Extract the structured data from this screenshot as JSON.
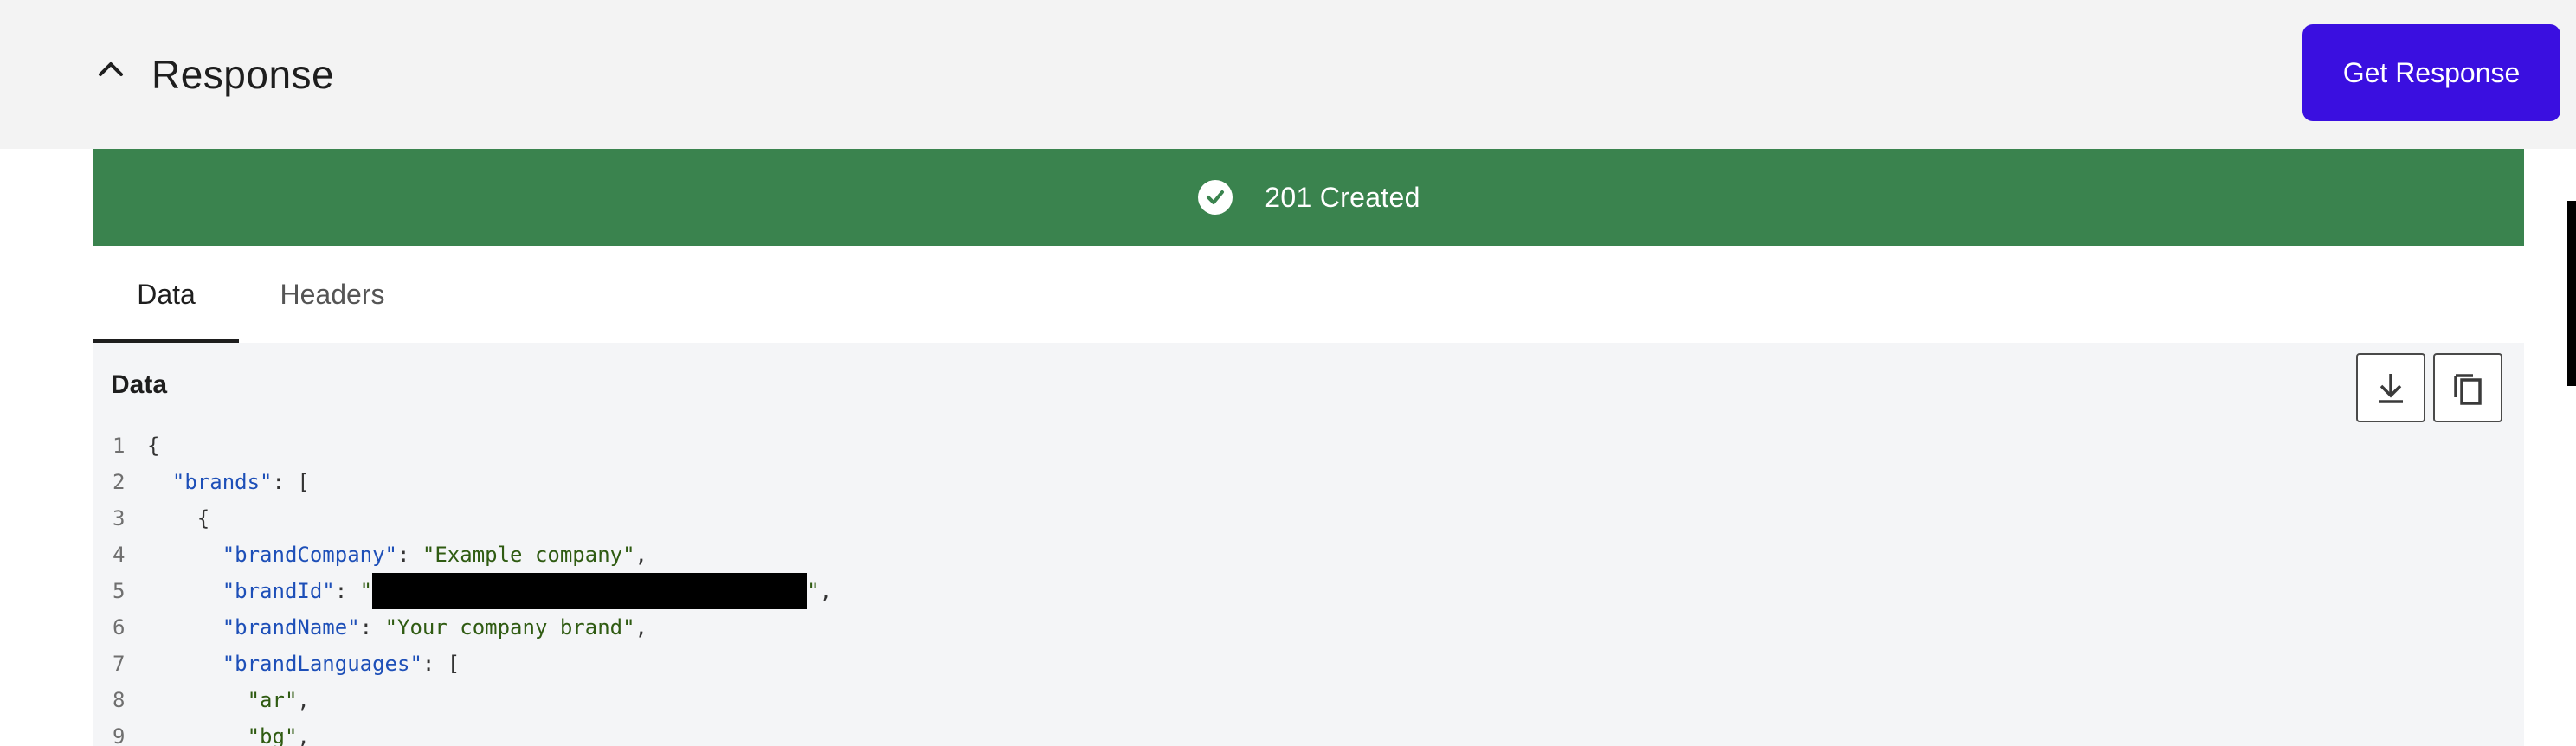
{
  "header": {
    "title": "Response",
    "get_response_label": "Get Response"
  },
  "status": {
    "text": "201 Created",
    "color": "#3a834e"
  },
  "tabs": [
    {
      "label": "Data",
      "active": true
    },
    {
      "label": "Headers",
      "active": false
    }
  ],
  "panel": {
    "title": "Data"
  },
  "code_lines": [
    {
      "n": "1",
      "indent": "",
      "parts": [
        {
          "c": "p",
          "t": "{"
        }
      ]
    },
    {
      "n": "2",
      "indent": "  ",
      "parts": [
        {
          "c": "k",
          "t": "\"brands\""
        },
        {
          "c": "p",
          "t": ": ["
        }
      ]
    },
    {
      "n": "3",
      "indent": "    ",
      "parts": [
        {
          "c": "p",
          "t": "{"
        }
      ]
    },
    {
      "n": "4",
      "indent": "      ",
      "parts": [
        {
          "c": "k",
          "t": "\"brandCompany\""
        },
        {
          "c": "p",
          "t": ": "
        },
        {
          "c": "s",
          "t": "\"Example company\""
        },
        {
          "c": "p",
          "t": ","
        }
      ]
    },
    {
      "n": "5",
      "indent": "      ",
      "parts": [
        {
          "c": "k",
          "t": "\"brandId\""
        },
        {
          "c": "p",
          "t": ": "
        },
        {
          "c": "s",
          "t": "\""
        },
        {
          "c": "redacted",
          "t": ""
        },
        {
          "c": "s",
          "t": "\""
        },
        {
          "c": "p",
          "t": ","
        }
      ]
    },
    {
      "n": "6",
      "indent": "      ",
      "parts": [
        {
          "c": "k",
          "t": "\"brandName\""
        },
        {
          "c": "p",
          "t": ": "
        },
        {
          "c": "s",
          "t": "\"Your company brand\""
        },
        {
          "c": "p",
          "t": ","
        }
      ]
    },
    {
      "n": "7",
      "indent": "      ",
      "parts": [
        {
          "c": "k",
          "t": "\"brandLanguages\""
        },
        {
          "c": "p",
          "t": ": ["
        }
      ]
    },
    {
      "n": "8",
      "indent": "        ",
      "parts": [
        {
          "c": "s",
          "t": "\"ar\""
        },
        {
          "c": "p",
          "t": ","
        }
      ]
    },
    {
      "n": "9",
      "indent": "        ",
      "parts": [
        {
          "c": "s",
          "t": "\"bg\""
        },
        {
          "c": "p",
          "t": ","
        }
      ]
    }
  ]
}
